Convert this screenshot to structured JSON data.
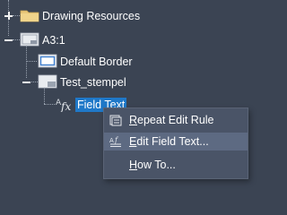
{
  "tree": {
    "nodes": [
      {
        "label": "Drawing Resources",
        "icon": "folder-icon",
        "expander": "plus"
      },
      {
        "label": "A3:1",
        "icon": "sheet-icon",
        "expander": "minus"
      },
      {
        "label": "Default Border",
        "icon": "border-icon"
      },
      {
        "label": "Test_stempel",
        "icon": "title-block-icon",
        "expander": "minus"
      },
      {
        "label": "Field Text",
        "icon": "field-function-icon",
        "selected": true
      }
    ]
  },
  "context_menu": {
    "items": [
      {
        "label_pre": "",
        "mnemonic": "R",
        "label_post": "epeat Edit Rule",
        "icon": "repeat-rule-icon"
      },
      {
        "label_pre": "",
        "mnemonic": "E",
        "label_post": "dit Field Text...",
        "icon": "edit-field-text-icon"
      },
      {
        "label_pre": "",
        "mnemonic": "H",
        "label_post": "ow To...",
        "icon": ""
      }
    ]
  },
  "colors": {
    "background": "#3b4453",
    "selection": "#1f78c8",
    "menu_background": "#4a5467",
    "menu_hover": "#5d6a82",
    "folder": "#e8c77a"
  }
}
